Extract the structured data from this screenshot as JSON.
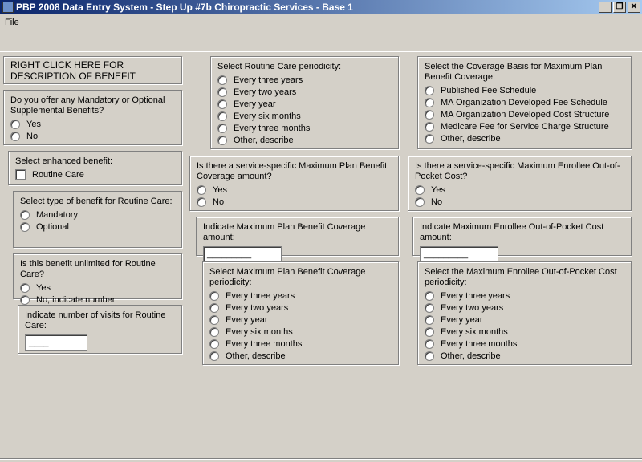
{
  "window": {
    "title": "PBP 2008 Data Entry System - Step Up #7b Chiropractic Services - Base 1",
    "minimize": "_",
    "restore": "❐",
    "close": "✕"
  },
  "menu": {
    "file": "File"
  },
  "banner": "RIGHT CLICK HERE FOR DESCRIPTION OF BENEFIT",
  "mandatory": {
    "question": "Do you offer any Mandatory or Optional Supplemental Benefits?",
    "options": [
      "Yes",
      "No"
    ]
  },
  "enhanced": {
    "question": "Select enhanced benefit:",
    "checkbox": "Routine Care"
  },
  "type": {
    "question": "Select type of benefit for Routine Care:",
    "options": [
      "Mandatory",
      "Optional"
    ]
  },
  "unlimited": {
    "question": "Is this benefit unlimited for Routine Care?",
    "options": [
      "Yes",
      "No, indicate number"
    ]
  },
  "visits": {
    "question": "Indicate number of visits for Routine Care:",
    "value": "____"
  },
  "periodicity": {
    "question": "Select Routine Care periodicity:",
    "options": [
      "Every three years",
      "Every two years",
      "Every year",
      "Every six months",
      "Every three months",
      "Other, describe"
    ]
  },
  "max_plan_q": {
    "question": "Is there a service-specific Maximum Plan Benefit Coverage amount?",
    "options": [
      "Yes",
      "No"
    ]
  },
  "max_plan_amt": {
    "question": "Indicate Maximum Plan Benefit Coverage amount:",
    "value": "_________"
  },
  "max_plan_period": {
    "question": "Select Maximum Plan Benefit Coverage periodicity:",
    "options": [
      "Every three years",
      "Every two years",
      "Every year",
      "Every six months",
      "Every three months",
      "Other, describe"
    ]
  },
  "coverage_basis": {
    "question": "Select the Coverage Basis for Maximum Plan Benefit Coverage:",
    "options": [
      "Published Fee Schedule",
      "MA Organization Developed Fee Schedule",
      "MA Organization Developed Cost Structure",
      "Medicare Fee for Service Charge Structure",
      "Other, describe"
    ]
  },
  "oop_q": {
    "question": "Is there a service-specific Maximum Enrollee Out-of-Pocket Cost?",
    "options": [
      "Yes",
      "No"
    ]
  },
  "oop_amt": {
    "question": "Indicate Maximum Enrollee Out-of-Pocket Cost amount:",
    "value": "_________"
  },
  "oop_period": {
    "question": "Select the Maximum Enrollee Out-of-Pocket Cost periodicity:",
    "options": [
      "Every three years",
      "Every two years",
      "Every year",
      "Every six months",
      "Every three months",
      "Other, describe"
    ]
  }
}
